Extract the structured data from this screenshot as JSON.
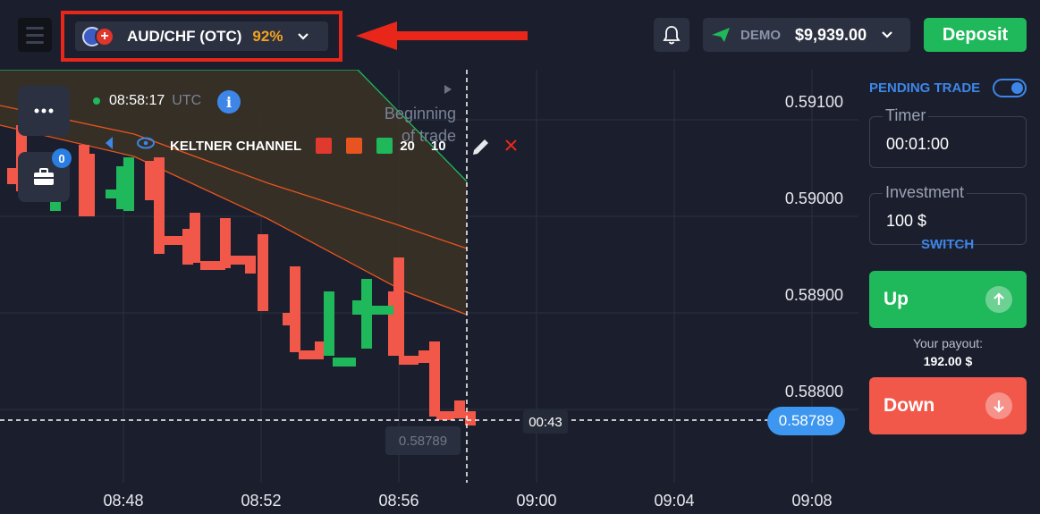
{
  "header": {
    "asset": {
      "name": "AUD/CHF (OTC)",
      "payout_pct": "92%"
    },
    "account": {
      "type": "DEMO",
      "balance": "$9,939.00"
    },
    "deposit_label": "Deposit"
  },
  "chart": {
    "price_labels": [
      "0.59100",
      "0.59000",
      "0.58900",
      "0.58800"
    ],
    "time_labels": [
      "08:48",
      "08:52",
      "08:56",
      "09:00",
      "09:04",
      "09:08"
    ],
    "clock": {
      "time": "08:58:17",
      "tz": "UTC"
    },
    "beginning_label": "Beginning of trade",
    "indicator": {
      "name": "KELTNER CHANNEL",
      "period": "20",
      "multiplier": "10"
    },
    "portfolio_count": "0",
    "countdown": "00:43",
    "open_price": "0.58789",
    "current_price": "0.58789",
    "colors": {
      "bull": "#1fb85a",
      "bear": "#f2584a",
      "upper_band": "#1fb85a",
      "lines": "#e8541f",
      "band_fill": "#3a3326"
    }
  },
  "panel": {
    "pending_label": "PENDING TRADE",
    "timer": {
      "label": "Timer",
      "value": "00:01:00"
    },
    "investment": {
      "label": "Investment",
      "value": "100 $"
    },
    "switch_label": "SWITCH",
    "up_label": "Up",
    "down_label": "Down",
    "payout_label": "Your payout:",
    "payout_value": "192.00 $"
  }
}
